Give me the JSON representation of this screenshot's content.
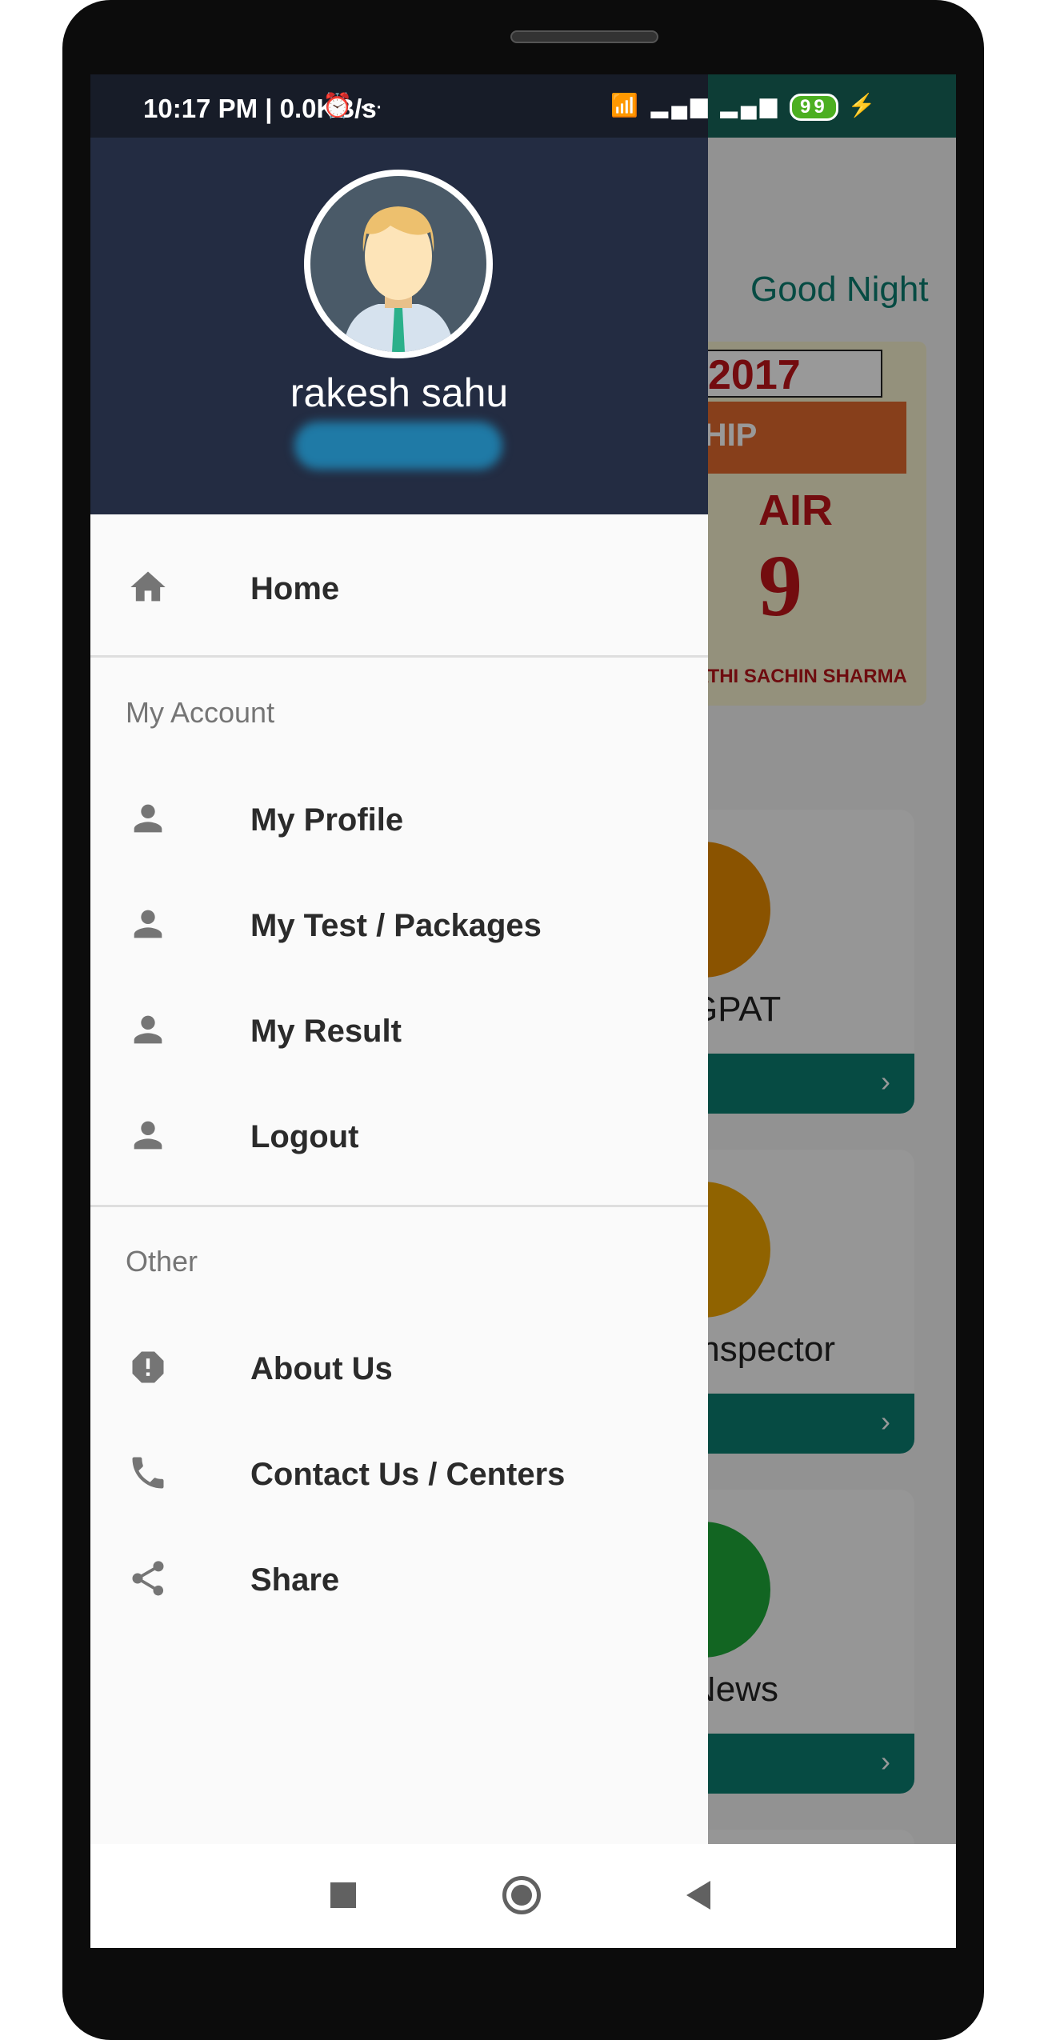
{
  "status_bar": {
    "time": "10:17 PM | 0.0KB/s",
    "icons": "wifi, VoLTE, signal, 4G",
    "battery": "99"
  },
  "background": {
    "greeting": "Good Night",
    "banner": {
      "year": "2017",
      "subtitle": "SHIP",
      "air": "AIR",
      "rank": "9",
      "names": "SATHI   SACHIN SHARMA"
    },
    "cards": [
      {
        "label": "GPAT",
        "color": "#e68a00"
      },
      {
        "label": "Inspector",
        "color": "#f0a500"
      },
      {
        "label": "News",
        "color": "#1fa83a"
      }
    ]
  },
  "drawer": {
    "user_name": "rakesh sahu",
    "home": "Home",
    "sections": [
      {
        "title": "My Account",
        "items": [
          {
            "label": "My Profile",
            "icon": "person-icon"
          },
          {
            "label": "My Test / Packages",
            "icon": "person-icon"
          },
          {
            "label": "My Result",
            "icon": "person-icon"
          },
          {
            "label": "Logout",
            "icon": "person-icon"
          }
        ]
      },
      {
        "title": "Other",
        "items": [
          {
            "label": "About Us",
            "icon": "info-alert-icon"
          },
          {
            "label": "Contact Us / Centers",
            "icon": "phone-icon"
          },
          {
            "label": "Share",
            "icon": "share-icon"
          }
        ]
      }
    ]
  },
  "colors": {
    "header": "#232c42",
    "accent": "#0b7d70"
  }
}
